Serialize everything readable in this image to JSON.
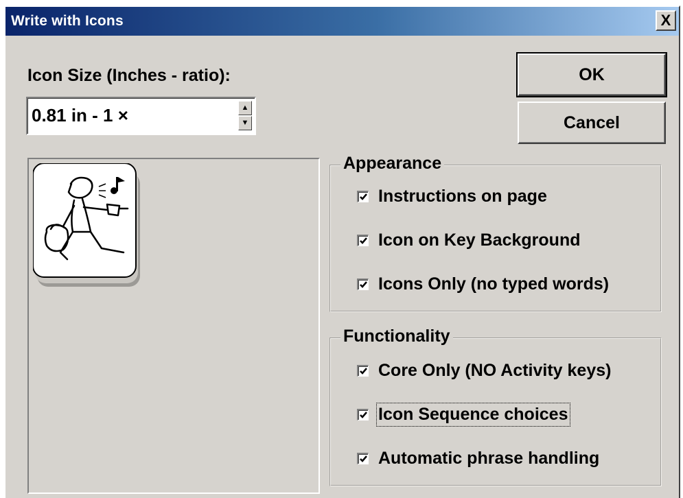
{
  "window": {
    "title": "Write with Icons",
    "close_glyph": "X"
  },
  "icon_size": {
    "label": "Icon Size (Inches - ratio):",
    "value": "0.81 in - 1 ×"
  },
  "buttons": {
    "ok_label": "OK",
    "cancel_label": "Cancel"
  },
  "preview": {
    "icon": "person-carrying-bag-and-drill-icon"
  },
  "appearance": {
    "title": "Appearance",
    "options": [
      {
        "label": "Instructions on page",
        "checked": true
      },
      {
        "label": "Icon on Key Background",
        "checked": true
      },
      {
        "label": "Icons Only (no typed words)",
        "checked": true
      }
    ]
  },
  "functionality": {
    "title": "Functionality",
    "options": [
      {
        "label": "Core Only (NO Activity keys)",
        "checked": true
      },
      {
        "label": "Icon Sequence choices",
        "checked": true,
        "focused": true
      },
      {
        "label": "Automatic phrase handling",
        "checked": true
      }
    ]
  },
  "colors": {
    "dialog_bg": "#d6d3ce",
    "title_bar_start": "#0a246a",
    "title_bar_end": "#a6caf0"
  }
}
